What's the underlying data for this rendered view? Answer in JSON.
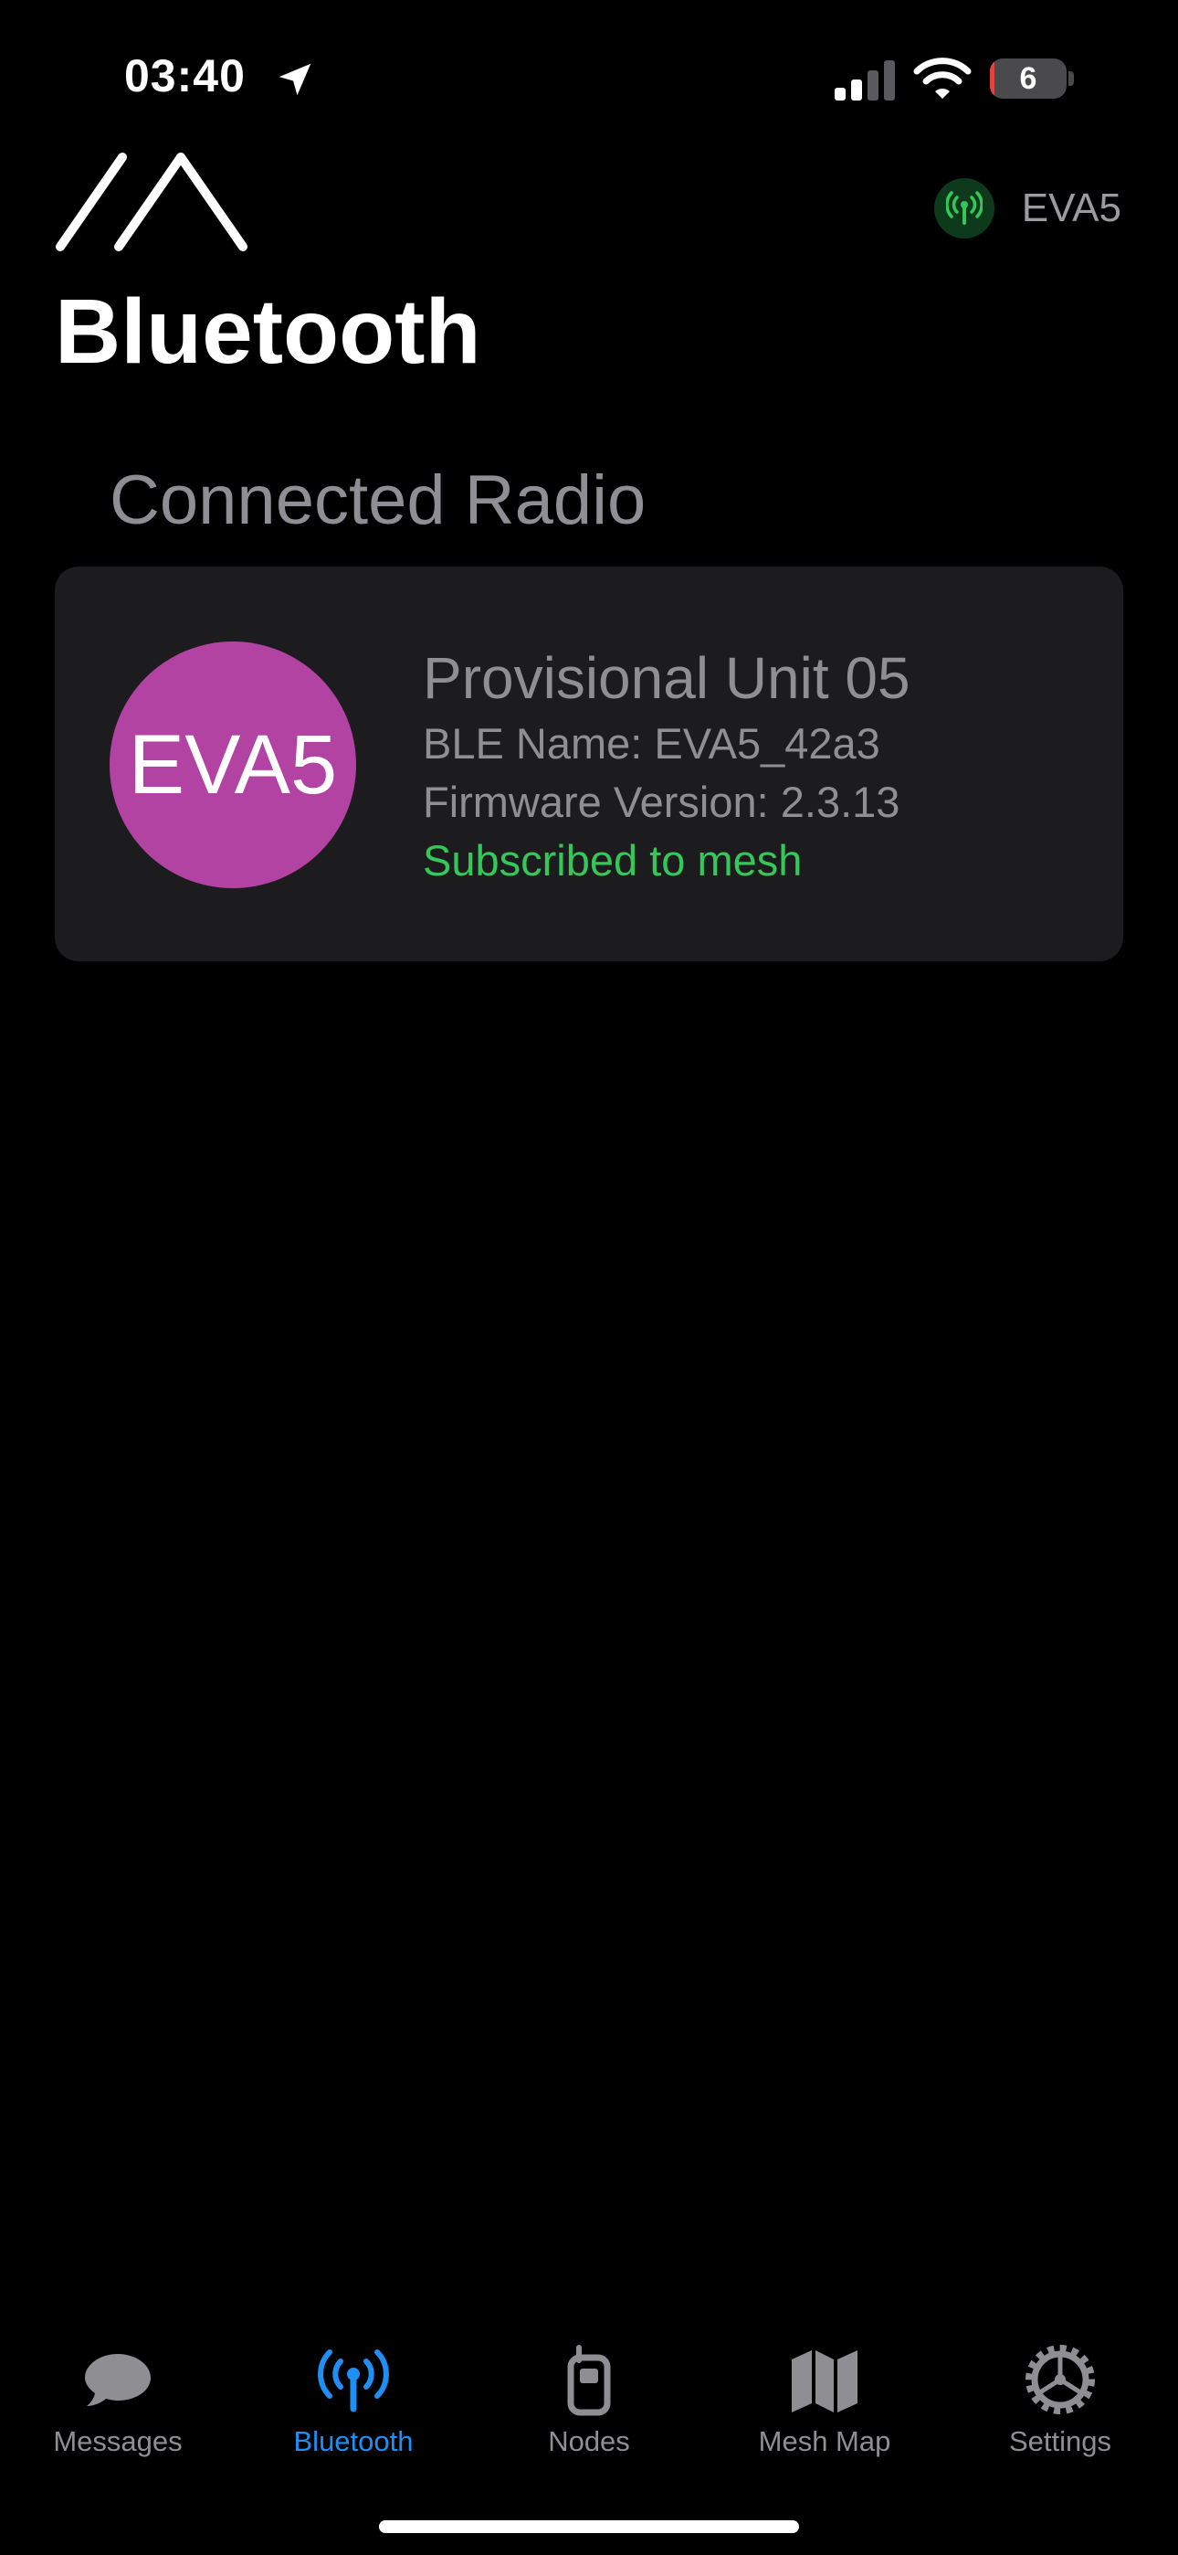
{
  "status_bar": {
    "time": "03:40",
    "battery_level": "6",
    "battery_fraction": 0.06,
    "icons": [
      "location-arrow-icon",
      "cellular-signal-icon",
      "wifi-icon",
      "battery-icon"
    ]
  },
  "header": {
    "logo_icon": "app-logo-icon",
    "connected_radio_short_name": "EVA5",
    "radio_icon": "antenna-icon",
    "title": "Bluetooth"
  },
  "connected_radio": {
    "section_title": "Connected Radio",
    "avatar_text": "EVA5",
    "avatar_color": "#b243a2",
    "device_name": "Provisional Unit 05",
    "ble_name": "BLE Name: EVA5_42a3",
    "firmware_version": "Firmware Version: 2.3.13",
    "status": "Subscribed to mesh",
    "status_color": "#34c759"
  },
  "tab_bar": {
    "active_color": "#1f8ff5",
    "inactive_color": "#8e8e93",
    "tabs": [
      {
        "label": "Messages",
        "icon": "message-bubble-icon",
        "active": false
      },
      {
        "label": "Bluetooth",
        "icon": "antenna-icon",
        "active": true
      },
      {
        "label": "Nodes",
        "icon": "handheld-radio-icon",
        "active": false
      },
      {
        "label": "Mesh Map",
        "icon": "map-icon",
        "active": false
      },
      {
        "label": "Settings",
        "icon": "gear-icon",
        "active": false
      }
    ]
  }
}
